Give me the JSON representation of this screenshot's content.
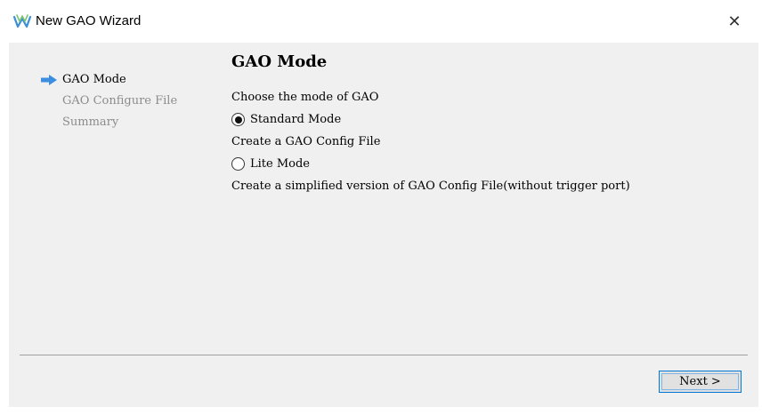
{
  "window": {
    "title": "New GAO Wizard",
    "close_glyph": "✕",
    "app_icon": "gowin-logo-icon",
    "accent_color": "#0078d7"
  },
  "nav": {
    "items": [
      {
        "label": "GAO Mode",
        "active": true
      },
      {
        "label": "GAO Configure File",
        "active": false
      },
      {
        "label": "Summary",
        "active": false
      }
    ],
    "current_indicator_icon": "arrow-right-icon"
  },
  "content": {
    "heading": "GAO Mode",
    "prompt": "Choose the mode of GAO",
    "options": [
      {
        "label": "Standard Mode",
        "selected": true,
        "description": "Create a GAO Config File"
      },
      {
        "label": "Lite Mode",
        "selected": false,
        "description": "Create a simplified version of GAO Config File(without trigger port)"
      }
    ]
  },
  "footer": {
    "next_label": "Next >"
  }
}
